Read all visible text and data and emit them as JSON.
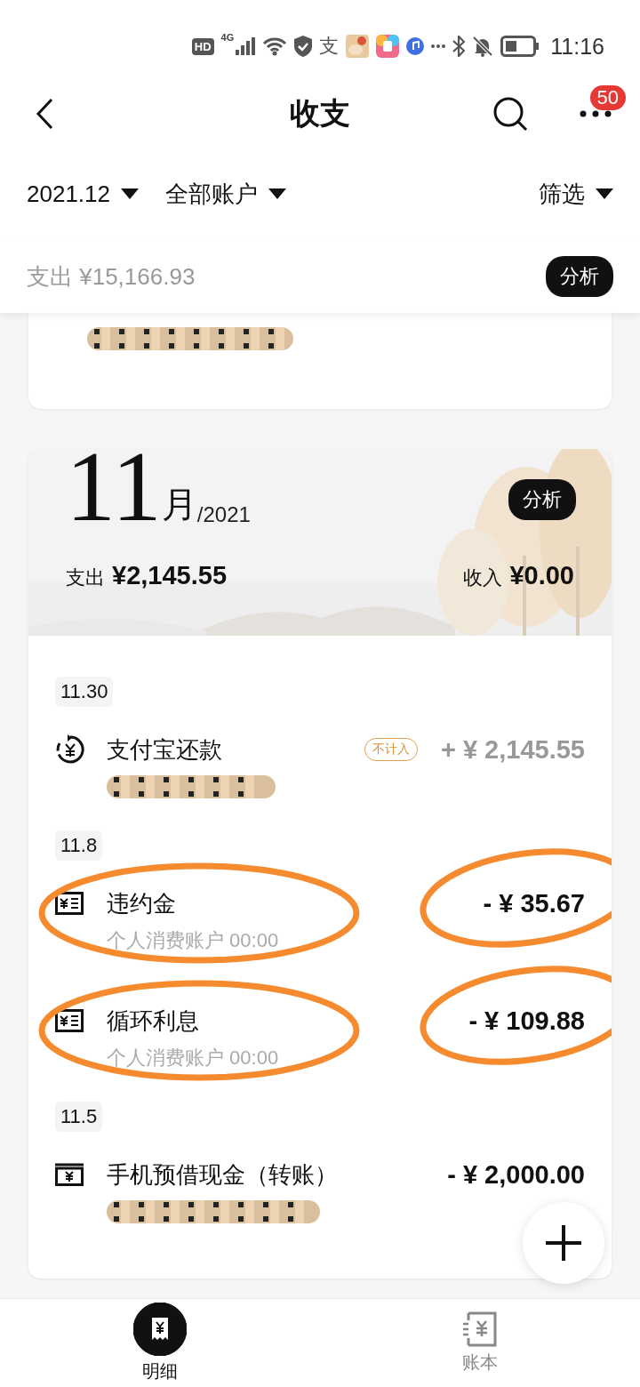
{
  "status_bar": {
    "hd": "HD",
    "network": "4G",
    "alipay": "支",
    "time": "11:16"
  },
  "header": {
    "title": "收支",
    "badge": "50"
  },
  "filters": [
    {
      "label": "2021.12"
    },
    {
      "label": "全部账户"
    },
    {
      "label": "筛选"
    }
  ],
  "summary": {
    "label": "支出 ¥15,166.93",
    "button": "分析"
  },
  "previous_card": {
    "redacted": true
  },
  "month": {
    "number": "11",
    "unit": "月",
    "year": "/2021",
    "button": "分析",
    "expense_label": "支出",
    "expense": "¥2,145.55",
    "income_label": "收入",
    "income": "¥0.00"
  },
  "groups": [
    {
      "date": "11.30",
      "items": [
        {
          "kind": "repay",
          "title": "支付宝还款",
          "tag": "不计入",
          "amount": "+ ¥ 2,145.55",
          "excluded": true,
          "redacted": true
        }
      ]
    },
    {
      "date": "11.8",
      "items": [
        {
          "kind": "bill",
          "title": "违约金",
          "subtitle": "个人消费账户 00:00",
          "amount": "- ¥ 35.67",
          "excluded": false,
          "circled": true
        },
        {
          "kind": "bill",
          "title": "循环利息",
          "subtitle": "个人消费账户 00:00",
          "amount": "- ¥ 109.88",
          "excluded": false,
          "circled": true
        }
      ]
    },
    {
      "date": "11.5",
      "items": [
        {
          "kind": "transfer",
          "title": "手机预借现金（转账）",
          "amount": "- ¥ 2,000.00",
          "excluded": false,
          "redacted": true
        }
      ]
    }
  ],
  "tabs": [
    {
      "label": "明细",
      "kind": "detail",
      "selected": true
    },
    {
      "label": "账本",
      "kind": "ledger",
      "selected": false
    }
  ]
}
